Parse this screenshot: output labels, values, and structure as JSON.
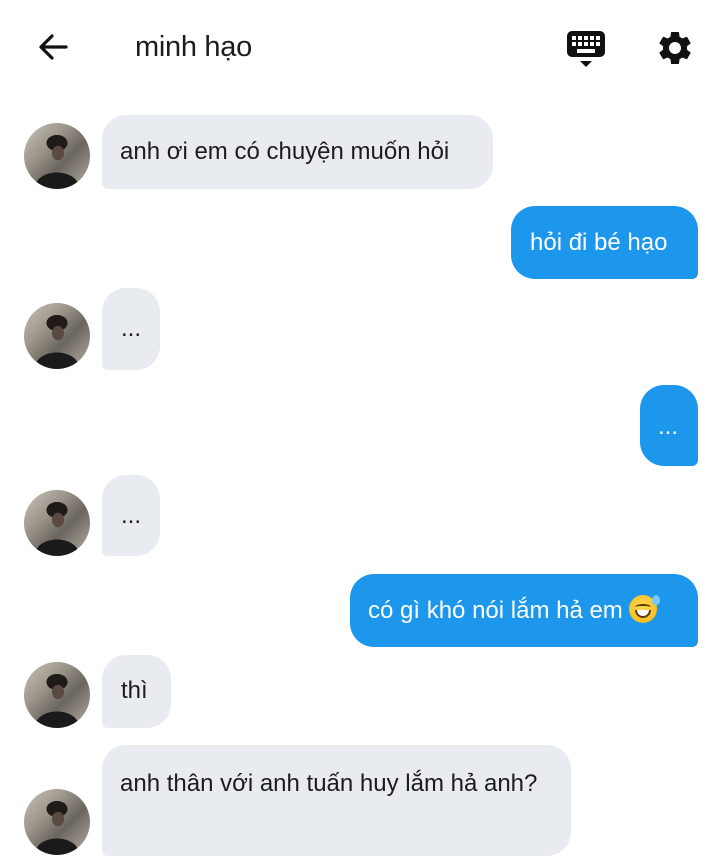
{
  "header": {
    "title": "minh hạo",
    "back_icon": "arrow-left-icon",
    "keyboard_icon": "keyboard-icon",
    "settings_icon": "gear-icon"
  },
  "colors": {
    "sent_bubble": "#1c97ec",
    "received_bubble": "#e8ebf0",
    "text": "#1c1c1c"
  },
  "messages": [
    {
      "from": "minh hạo",
      "text": "anh ơi em có chuyện muốn hỏi"
    },
    {
      "from": "me",
      "text": "hỏi đi bé hạo"
    },
    {
      "from": "minh hạo",
      "text": "..."
    },
    {
      "from": "me",
      "text": "..."
    },
    {
      "from": "minh hạo",
      "text": "..."
    },
    {
      "from": "me",
      "text": "có gì khó nói lắm hả em",
      "emoji": "grinning-sweat-emoji"
    },
    {
      "from": "minh hạo",
      "text": "thì"
    },
    {
      "from": "minh hạo",
      "text": "anh thân với anh tuấn huy lắm hả anh?"
    }
  ]
}
